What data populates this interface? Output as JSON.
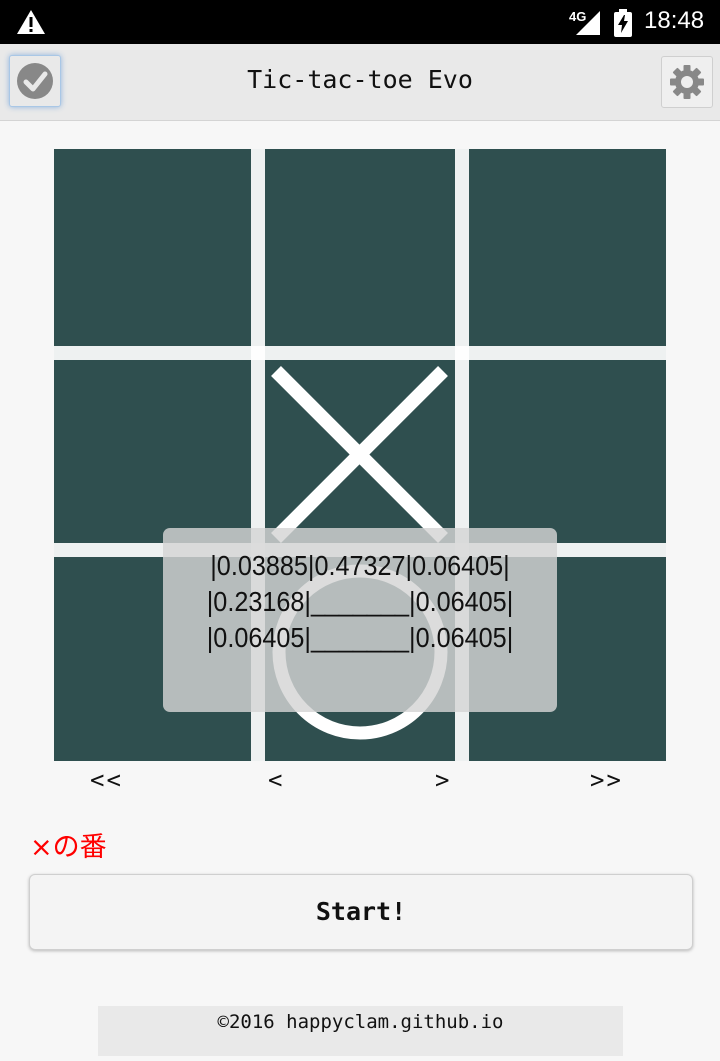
{
  "status_bar": {
    "network": "4G",
    "time": "18:48",
    "icons": [
      "warning-icon",
      "signal-icon",
      "battery-charging-icon"
    ]
  },
  "header": {
    "title": "Tic-tac-toe Evo",
    "left_icon": "check-icon",
    "right_icon": "gear-icon"
  },
  "board": {
    "cells": [
      "",
      "",
      "",
      "",
      "X",
      "",
      "",
      "O",
      ""
    ],
    "colors": {
      "background": "#2f4f4f",
      "lines": "#ffffff"
    }
  },
  "evaluation": {
    "rows": [
      "|0.03885|0.47327|0.06405|",
      "|0.23168|_______|0.06405|",
      "|0.06405|_______|0.06405|"
    ]
  },
  "nav": {
    "first": "<<",
    "prev": "<",
    "next": ">",
    "last": ">>"
  },
  "turn_status": "×の番",
  "start_button": "Start!",
  "footer": "©2016 happyclam.github.io",
  "colors": {
    "status_text": "#ff0000",
    "header_bg": "#e9e9e9"
  }
}
